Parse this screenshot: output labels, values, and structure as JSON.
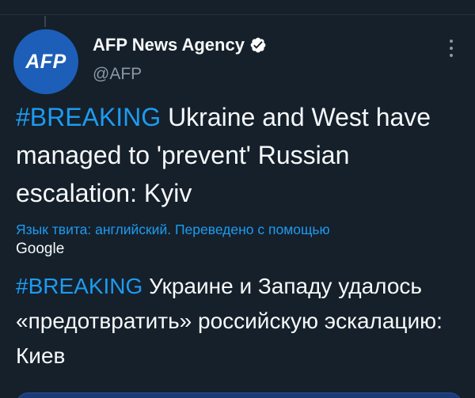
{
  "tweet": {
    "author": {
      "avatar_text": "AFP",
      "display_name": "AFP News Agency",
      "handle": "@AFP",
      "verified": true
    },
    "text": {
      "hashtag": "#BREAKING",
      "body": "Ukraine and West have managed to 'prevent' Russian escalation: Kyiv"
    },
    "translation": {
      "note": "Язык твита: английский. Переведено с помощью",
      "provider": "Google",
      "hashtag": "#BREAKING",
      "body": "Украине и Западу удалось «предотвратить» российскую эскалацию: Киев"
    }
  },
  "colors": {
    "background": "#15202b",
    "accent": "#1d9bf0",
    "text_primary": "#f7f9f9",
    "text_secondary": "#8b98a5",
    "avatar_bg": "#1d5eb8"
  },
  "icons": {
    "verified": "verified-badge-icon",
    "more": "more-options-icon"
  }
}
